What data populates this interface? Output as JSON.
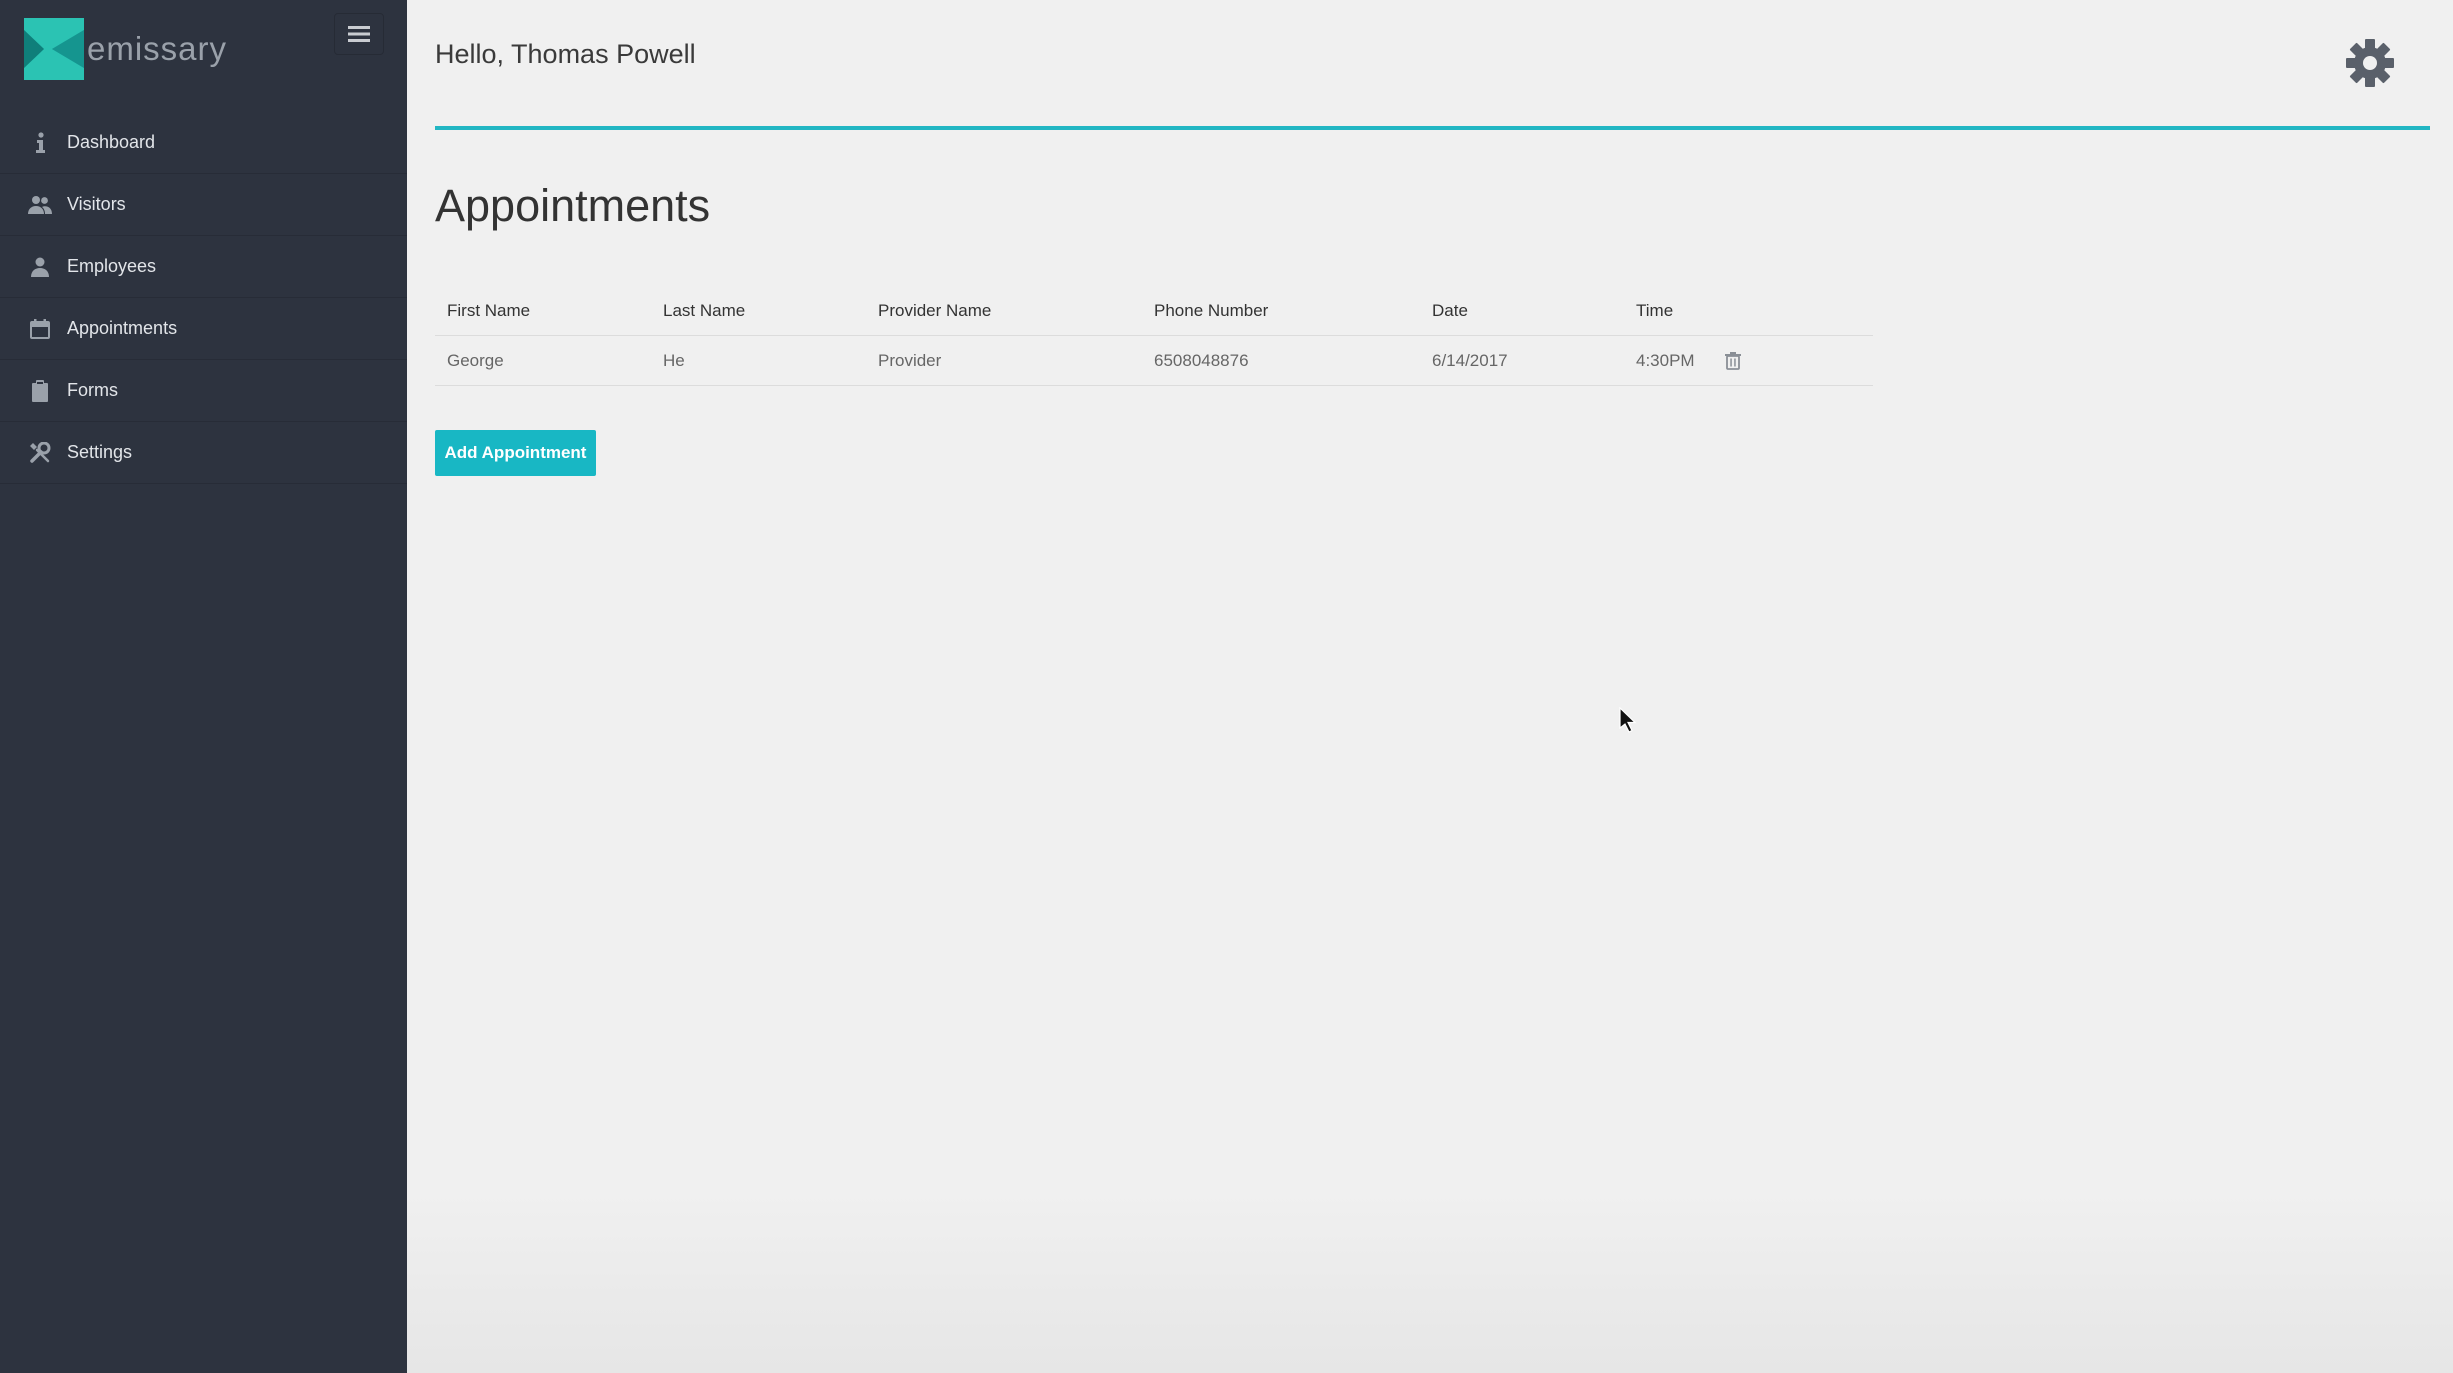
{
  "brand": {
    "name": "emissary",
    "accent_color": "#22b6c3",
    "sidebar_color": "#2d333f"
  },
  "sidebar": {
    "items": [
      {
        "label": "Dashboard",
        "icon": "info-icon"
      },
      {
        "label": "Visitors",
        "icon": "users-icon"
      },
      {
        "label": "Employees",
        "icon": "user-icon"
      },
      {
        "label": "Appointments",
        "icon": "calendar-icon"
      },
      {
        "label": "Forms",
        "icon": "clipboard-icon"
      },
      {
        "label": "Settings",
        "icon": "wrench-icon"
      }
    ]
  },
  "header": {
    "greeting": "Hello, Thomas Powell"
  },
  "main": {
    "title": "Appointments",
    "table": {
      "columns": [
        "First Name",
        "Last Name",
        "Provider Name",
        "Phone Number",
        "Date",
        "Time"
      ],
      "rows": [
        [
          "George",
          "He",
          "Provider",
          "6508048876",
          "6/14/2017",
          "4:30PM"
        ]
      ]
    },
    "add_button_label": "Add Appointment"
  }
}
